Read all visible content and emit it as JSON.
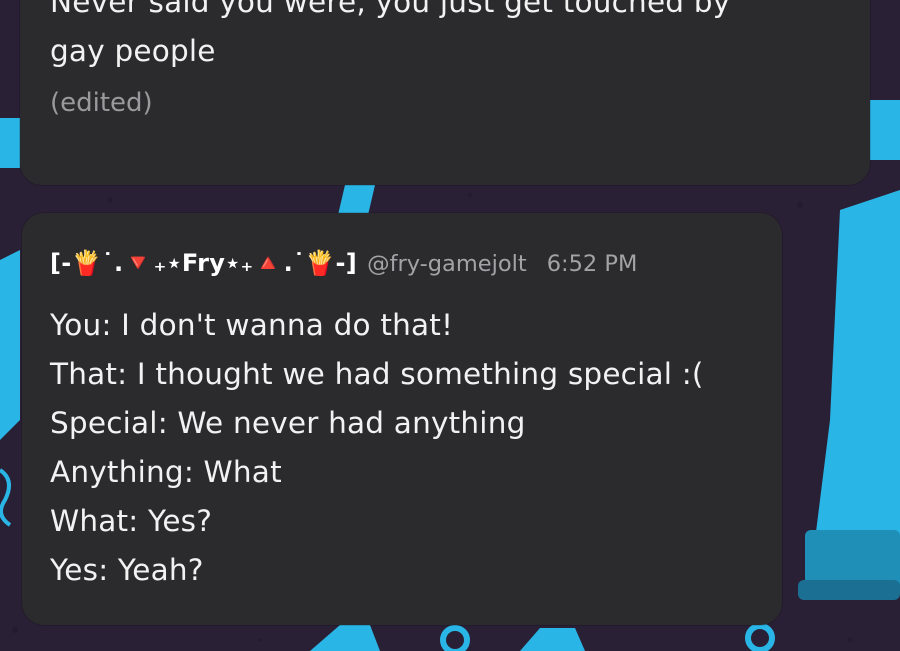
{
  "messages": [
    {
      "text_lines": [
        "Never said you were, you just get touched by",
        "gay people"
      ],
      "edited_label": "(edited)"
    },
    {
      "username": "[-🍟˙.🔻₊⋆Fry⋆₊🔺.˙🍟-]",
      "handle": "@fry-gamejolt",
      "timestamp": "6:52 PM",
      "text_lines": [
        "You: I don't wanna do that!",
        "That: I thought we had something special :(",
        "Special: We never had anything",
        "Anything: What",
        "What: Yes?",
        "Yes: Yeah?"
      ]
    }
  ],
  "colors": {
    "background": "#2a2035",
    "pattern_accent": "#29b6e6",
    "bubble": "#2b2a2d",
    "text": "#f2f2f2",
    "muted_text": "#a3a3a6"
  }
}
